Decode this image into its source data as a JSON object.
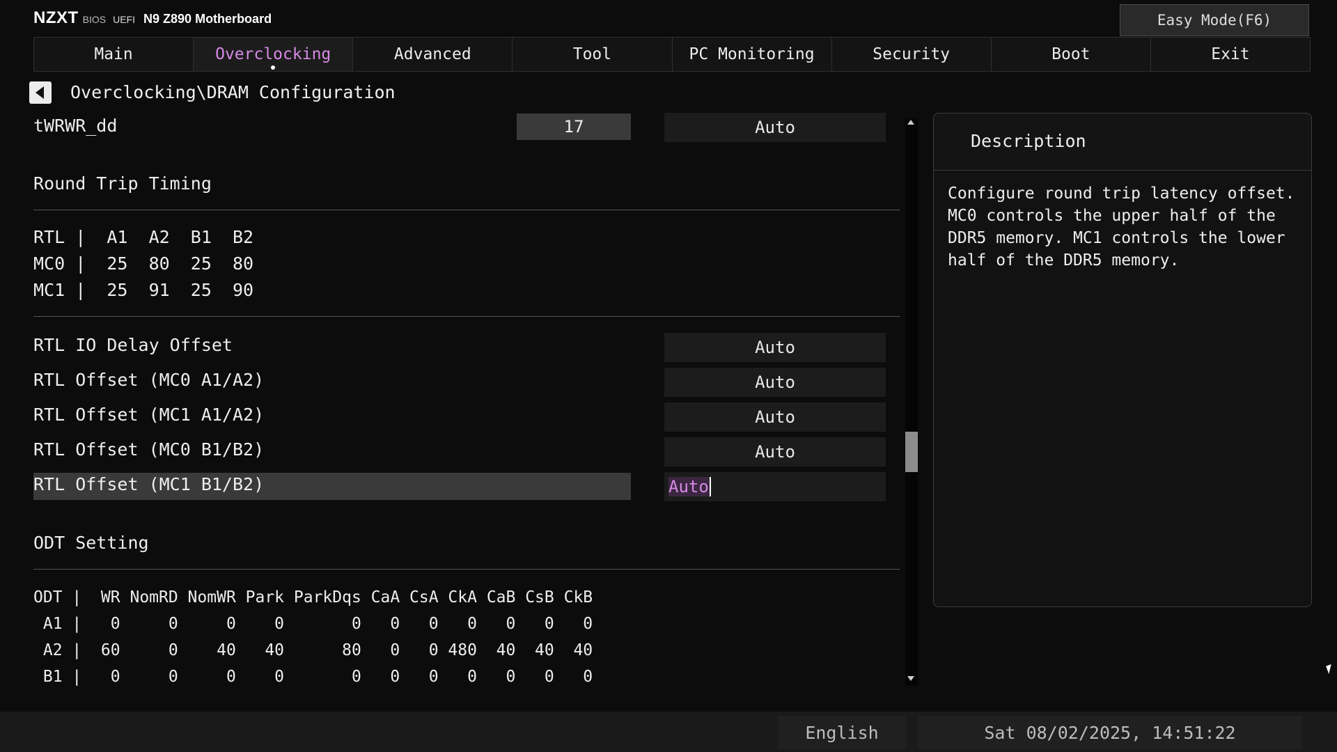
{
  "brand": {
    "logo": "NZXT",
    "bios": "BIOS",
    "uefi": "UEFI",
    "model": "N9 Z890 Motherboard"
  },
  "easy_mode_label": "Easy Mode(F6)",
  "tabs": [
    "Main",
    "Overclocking",
    "Advanced",
    "Tool",
    "PC Monitoring",
    "Security",
    "Boot",
    "Exit"
  ],
  "active_tab": "Overclocking",
  "breadcrumb": "Overclocking\\DRAM Configuration",
  "twrwr": {
    "label": "tWRWR_dd",
    "value": "17",
    "option": "Auto"
  },
  "rtt_section": {
    "title": "Round Trip Timing",
    "lines": [
      "RTL |  A1  A2  B1  B2",
      "MC0 |  25  80  25  80",
      "MC1 |  25  91  25  90"
    ]
  },
  "rtl_settings": [
    {
      "label": "RTL IO Delay Offset",
      "value": "Auto"
    },
    {
      "label": "RTL Offset (MC0 A1/A2)",
      "value": "Auto"
    },
    {
      "label": "RTL Offset (MC1 A1/A2)",
      "value": "Auto"
    },
    {
      "label": "RTL Offset (MC0 B1/B2)",
      "value": "Auto"
    },
    {
      "label": "RTL Offset (MC1 B1/B2)",
      "value": "Auto"
    }
  ],
  "odt_section": {
    "title": "ODT Setting",
    "lines": [
      "ODT |  WR NomRD NomWR Park ParkDqs CaA CsA CkA CaB CsB CkB",
      " A1 |   0     0     0    0       0   0   0   0   0   0   0",
      " A2 |  60     0    40   40      80   0   0 480  40  40  40",
      " B1 |   0     0     0    0       0   0   0   0   0   0   0"
    ]
  },
  "description": {
    "title": "Description",
    "text": "Configure round trip latency offset.\nMC0 controls the upper half of the\nDDR5 memory. MC1 controls the lower\nhalf of the DDR5 memory."
  },
  "footer": {
    "language": "English",
    "datetime": "Sat 08/02/2025, 14:51:22"
  }
}
